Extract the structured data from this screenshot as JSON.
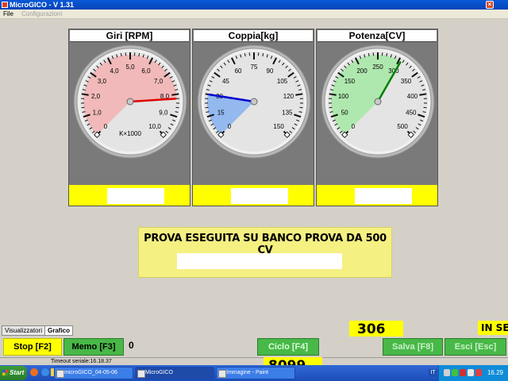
{
  "window": {
    "title": "MicroGICO - V 1.31",
    "close_glyph": "×"
  },
  "menu": {
    "file": "File",
    "configurazioni": "Configurazioni"
  },
  "gauges": [
    {
      "title": "Giri [RPM]",
      "unit_label": "K×1000",
      "ticks": [
        "0",
        "1,0",
        "2,0",
        "3,0",
        "4,0",
        "5,0",
        "6,0",
        "7,0",
        "8,0",
        "9,0",
        "10,0"
      ],
      "min": 0,
      "max": 10,
      "needle": 8.2,
      "sector_color": "#f2b4b4",
      "needle_color": "#e00000"
    },
    {
      "title": "Coppia[kg]",
      "unit_label": "",
      "ticks": [
        "0",
        "15",
        "30",
        "45",
        "60",
        "75",
        "90",
        "105",
        "120",
        "135",
        "150"
      ],
      "min": 0,
      "max": 150,
      "needle": 30,
      "sector_color": "#8ab4f0",
      "needle_color": "#0000d0"
    },
    {
      "title": "Potenza[CV]",
      "unit_label": "",
      "ticks": [
        "0",
        "50",
        "100",
        "150",
        "200",
        "250",
        "300",
        "350",
        "400",
        "450",
        "500"
      ],
      "min": 0,
      "max": 500,
      "needle": 305,
      "sector_color": "#a8e8a8",
      "needle_color": "#008000"
    }
  ],
  "banner": {
    "text": "PROVA ESEGUITA SU BANCO PROVA DA 500 CV"
  },
  "tabs": {
    "visualizzatori": "Visualizzatori",
    "grafico": "Grafico"
  },
  "buttons": {
    "stop": "Stop [F2]",
    "memo": "Memo [F3]",
    "ciclo": "Ciclo [F4]",
    "salva": "Salva [F8]",
    "esci": "Esci [Esc]"
  },
  "counter": "0",
  "readouts": {
    "value_306": "306",
    "in_se": "IN SE",
    "value_8099": "8099"
  },
  "status": {
    "timeout": "Timeout seriale:16.18.37"
  },
  "taskbar": {
    "start": "Start",
    "tasks": [
      "microGICO_04-05-06",
      "MicroGICO",
      "Immagine - Paint"
    ],
    "lang": "IT",
    "clock": "16.29"
  }
}
